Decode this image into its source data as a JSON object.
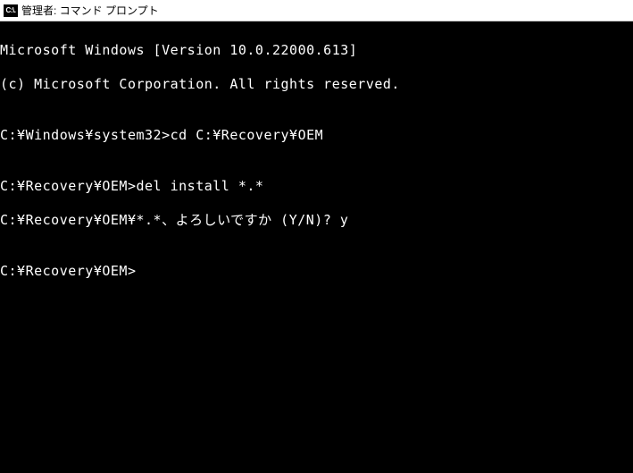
{
  "titlebar": {
    "icon_text": "C:\\.",
    "title": "管理者: コマンド プロンプト"
  },
  "terminal": {
    "lines": [
      "Microsoft Windows [Version 10.0.22000.613]",
      "(c) Microsoft Corporation. All rights reserved.",
      "",
      "C:¥Windows¥system32>cd C:¥Recovery¥OEM",
      "",
      "C:¥Recovery¥OEM>del install *.*",
      "C:¥Recovery¥OEM¥*.*、よろしいですか (Y/N)? y",
      "",
      "C:¥Recovery¥OEM>"
    ]
  }
}
